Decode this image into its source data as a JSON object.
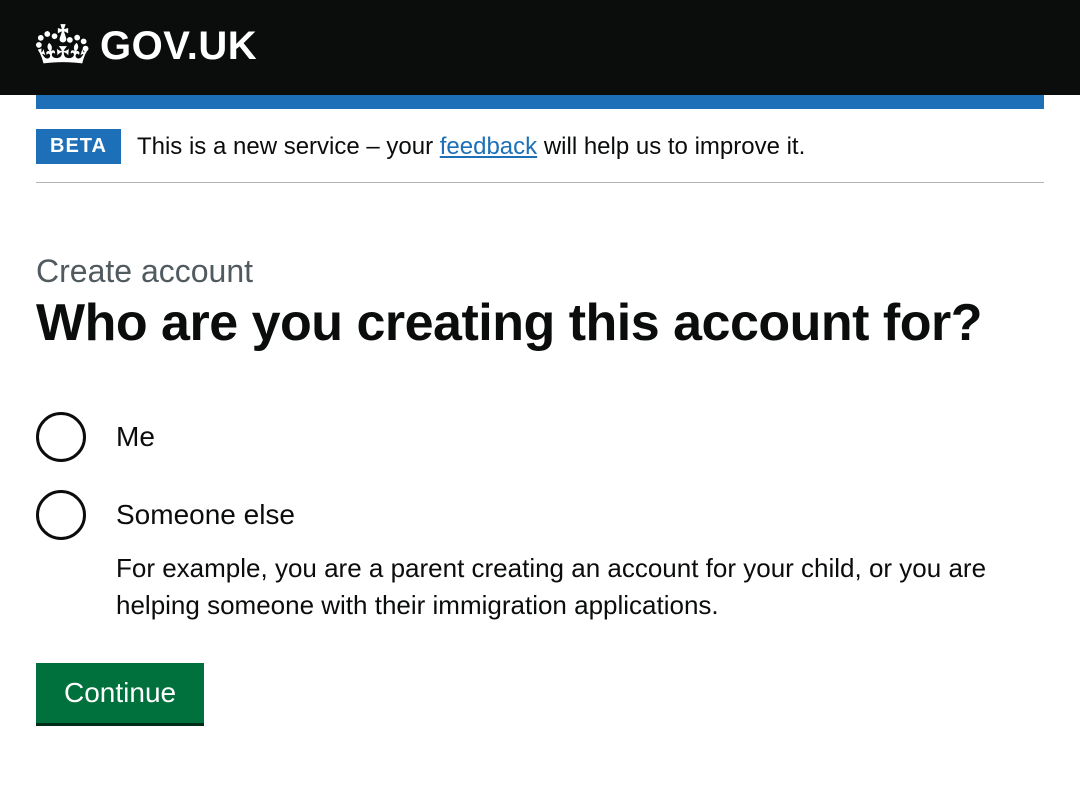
{
  "header": {
    "site_title": "GOV.UK"
  },
  "phase_banner": {
    "tag": "BETA",
    "text_before": "This is a new service – your ",
    "link": "feedback",
    "text_after": " will help us to improve it."
  },
  "page": {
    "caption": "Create account",
    "heading": "Who are you creating this account for?"
  },
  "radios": {
    "options": [
      {
        "label": "Me",
        "hint": ""
      },
      {
        "label": "Someone else",
        "hint": "For example, you are a parent creating an account for your child, or you are helping someone with their immigration applications."
      }
    ]
  },
  "actions": {
    "continue": "Continue"
  }
}
